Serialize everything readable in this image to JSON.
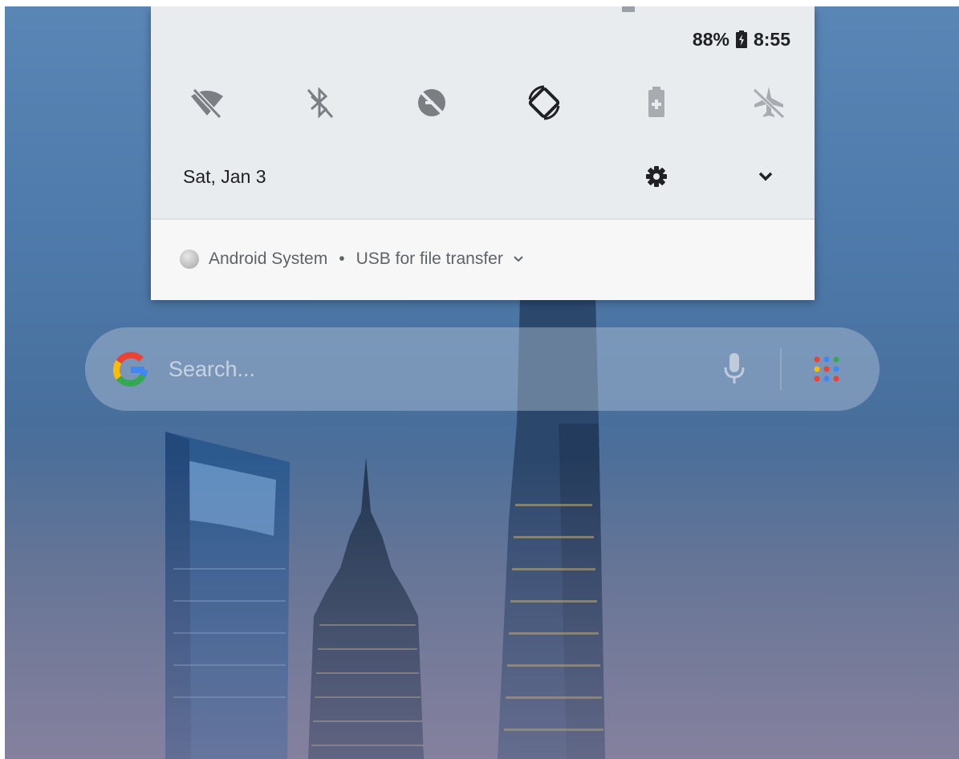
{
  "status_bar": {
    "battery_percent": "88%",
    "time": "8:55"
  },
  "quick_settings": {
    "tiles": [
      {
        "name": "wifi-off",
        "icon": "wifi-off-icon"
      },
      {
        "name": "bluetooth-off",
        "icon": "bluetooth-off-icon"
      },
      {
        "name": "do-not-disturb-off",
        "icon": "dnd-off-icon"
      },
      {
        "name": "auto-rotate",
        "icon": "auto-rotate-icon"
      },
      {
        "name": "battery-saver",
        "icon": "battery-saver-icon"
      },
      {
        "name": "airplane-mode-off",
        "icon": "airplane-off-icon"
      }
    ],
    "date": "Sat, Jan 3"
  },
  "notification": {
    "app": "Android System",
    "separator": "•",
    "title": "USB for file transfer",
    "expand": "⌄"
  },
  "search_bar": {
    "placeholder": "Search..."
  },
  "colors": {
    "shade_bg": "#e9ecef",
    "notification_bg": "#f7f7f7",
    "icon_dim": "#7b7f84",
    "icon_active": "#202124"
  }
}
